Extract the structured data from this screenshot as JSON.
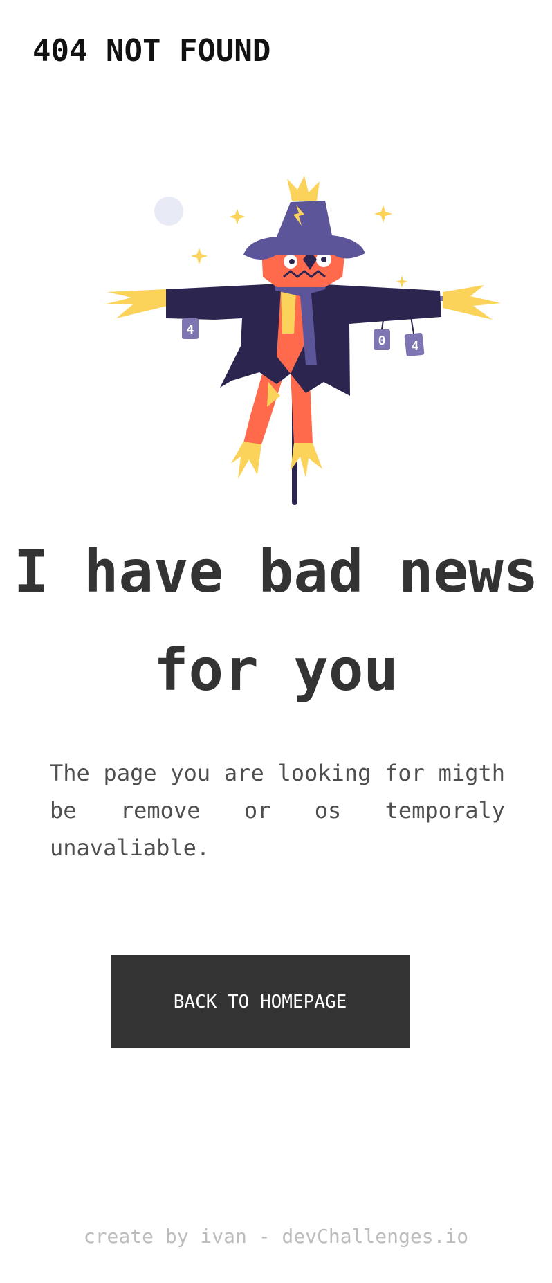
{
  "header": {
    "brand": "404 NOT FOUND"
  },
  "illustration": {
    "name": "scarecrow",
    "can_labels": [
      "4",
      "0",
      "4"
    ]
  },
  "main": {
    "headline": "I have bad news for you",
    "message": "The page you are looking for migth be remove or os temporaly unavaliable.",
    "button_label": "BACK TO HOMEPAGE"
  },
  "footer": {
    "credit": "create by ivan - devChallenges.io"
  },
  "colors": {
    "text": "#333333",
    "button_bg": "#333333",
    "button_text": "#ffffff",
    "footer_text": "#bdbdbd",
    "coat": "#2b2550",
    "hat": "#5d5599",
    "head": "#ff6a4d",
    "straw": "#fbd25a"
  }
}
